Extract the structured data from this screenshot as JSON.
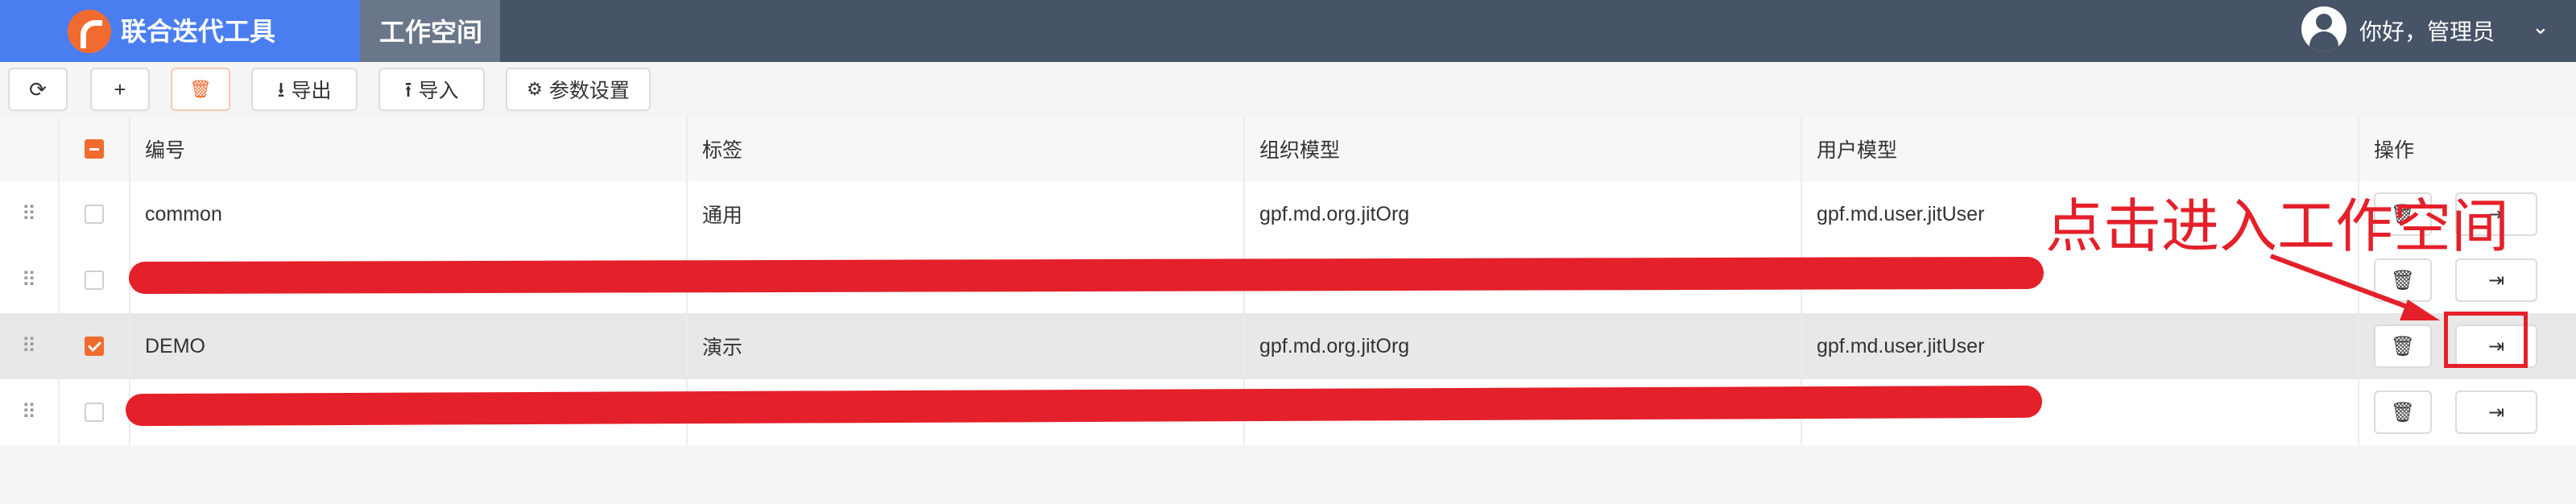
{
  "header": {
    "app_title": "联合迭代工具",
    "nav_tab": "工作空间",
    "user_greeting": "你好，管理员"
  },
  "toolbar": {
    "refresh_icon": "⟳",
    "add_icon": "+",
    "delete_icon": "🗑",
    "export_icon": "⭳",
    "export_label": "导出",
    "import_icon": "⭱",
    "import_label": "导入",
    "settings_icon": "⚙",
    "settings_label": "参数设置"
  },
  "table": {
    "columns": {
      "code": "编号",
      "label": "标签",
      "org_model": "组织模型",
      "user_model": "用户模型",
      "actions": "操作"
    },
    "rows": [
      {
        "code": "common",
        "label": "通用",
        "org_model": "gpf.md.org.jitOrg",
        "user_model": "gpf.md.user.jitUser",
        "checked": false
      },
      {
        "code": "",
        "label": "",
        "org_model": "",
        "user_model": "",
        "checked": false,
        "redacted": true
      },
      {
        "code": "DEMO",
        "label": "演示",
        "org_model": "gpf.md.org.jitOrg",
        "user_model": "gpf.md.user.jitUser",
        "checked": true
      },
      {
        "code": "",
        "label": "",
        "org_model": "",
        "user_model": "",
        "checked": false,
        "redacted": true
      }
    ],
    "delete_icon": "🗑",
    "enter_icon": "⇥"
  },
  "annotation": {
    "text": "点击进入工作空间",
    "color": "#e4202a"
  },
  "colors": {
    "brand": "#4a7ef0",
    "topbar": "#475366",
    "accent": "#f26b2e"
  }
}
